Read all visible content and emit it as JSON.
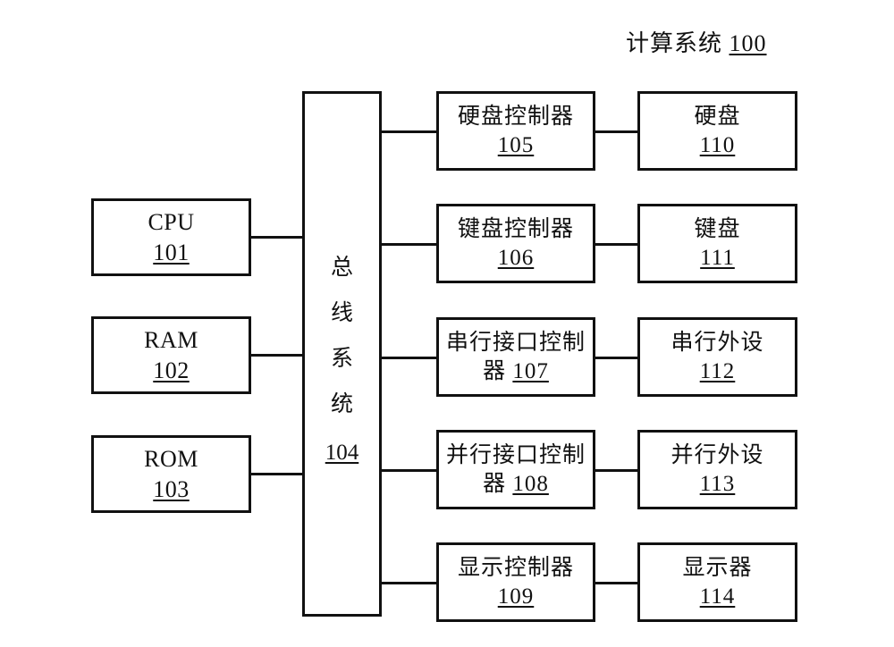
{
  "diagram": {
    "title_text": "计算系统",
    "title_ref": "100",
    "bus": {
      "chars": [
        "总",
        "线",
        "系",
        "统"
      ],
      "ref": "104"
    },
    "left_column": [
      {
        "name": "CPU",
        "ref": "101"
      },
      {
        "name": "RAM",
        "ref": "102"
      },
      {
        "name": "ROM",
        "ref": "103"
      }
    ],
    "controller_column": [
      {
        "line1": "硬盘控制器",
        "line2": "",
        "ref": "105",
        "wrap": false
      },
      {
        "line1": "键盘控制器",
        "line2": "",
        "ref": "106",
        "wrap": false
      },
      {
        "line1": "串行接口控制",
        "line2": "器",
        "ref": "107",
        "wrap": true
      },
      {
        "line1": "并行接口控制",
        "line2": "器",
        "ref": "108",
        "wrap": true
      },
      {
        "line1": "显示控制器",
        "line2": "",
        "ref": "109",
        "wrap": false
      }
    ],
    "device_column": [
      {
        "name": "硬盘",
        "ref": "110"
      },
      {
        "name": "键盘",
        "ref": "111"
      },
      {
        "name": "串行外设",
        "ref": "112"
      },
      {
        "name": "并行外设",
        "ref": "113"
      },
      {
        "name": "显示器",
        "ref": "114"
      }
    ]
  }
}
